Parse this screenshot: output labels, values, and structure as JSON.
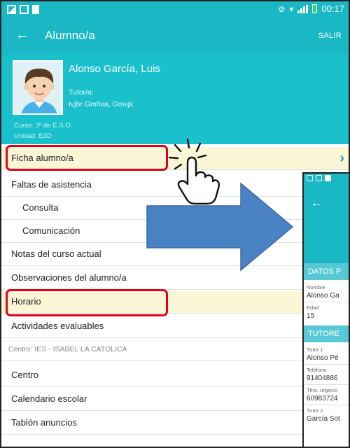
{
  "status_bar": {
    "time": "00:17",
    "left_icons": [
      "gallery-icon",
      "message-icon",
      "file-icon"
    ],
    "right_icons": [
      "silent-icon",
      "wifi-icon",
      "signal-icon",
      "battery-icon"
    ]
  },
  "app_bar": {
    "back_icon": "back-arrow-icon",
    "title": "Alumno/a",
    "logout_label": "SALIR"
  },
  "profile": {
    "name": "Alonso García, Luis",
    "tutor_label": "Tutor/a:",
    "tutor_name": "Ivjbr Gmñxa, Gmvjx",
    "course": "Curso:  3º de E.S.O.",
    "unit": "Unidad: E3D"
  },
  "menu": {
    "student_file": "Ficha alumno/a",
    "absences": "Faltas de asistencia",
    "absences_query": "Consulta",
    "absences_communication": "Comunicación",
    "grades": "Notas del curso actual",
    "observations": "Observaciones del alumno/a",
    "schedule": "Horario",
    "evaluable_activities": "Actividades evaluables",
    "school_section": "Centro: IES - ISABEL LA CATOLICA",
    "school": "Centro",
    "school_calendar": "Calendario escolar",
    "notice_board": "Tablón anuncios"
  },
  "student_detail_preview": {
    "personal_data_header": "DATOS P",
    "name_label": "Nombre",
    "name_value": "Alonso Ga",
    "age_label": "Edad",
    "age_value": "15",
    "tutors_header": "TUTORE",
    "tutor1_label": "Tutor 1",
    "tutor1_value": "Alonso Pé",
    "phone_label": "Teléfono",
    "phone_value": "91404886",
    "emergency_phone_label": "Tfno. urgenci",
    "emergency_phone_value": "60983724",
    "tutor2_label": "Tutor 2",
    "tutor2_value": "García Sot"
  },
  "colors": {
    "accent": "#1ab8c4",
    "highlight_box": "#e3001b",
    "highlight_fill": "#fbf6d6",
    "arrow": "#4a82c3",
    "chevron": "#1aa0bf"
  }
}
